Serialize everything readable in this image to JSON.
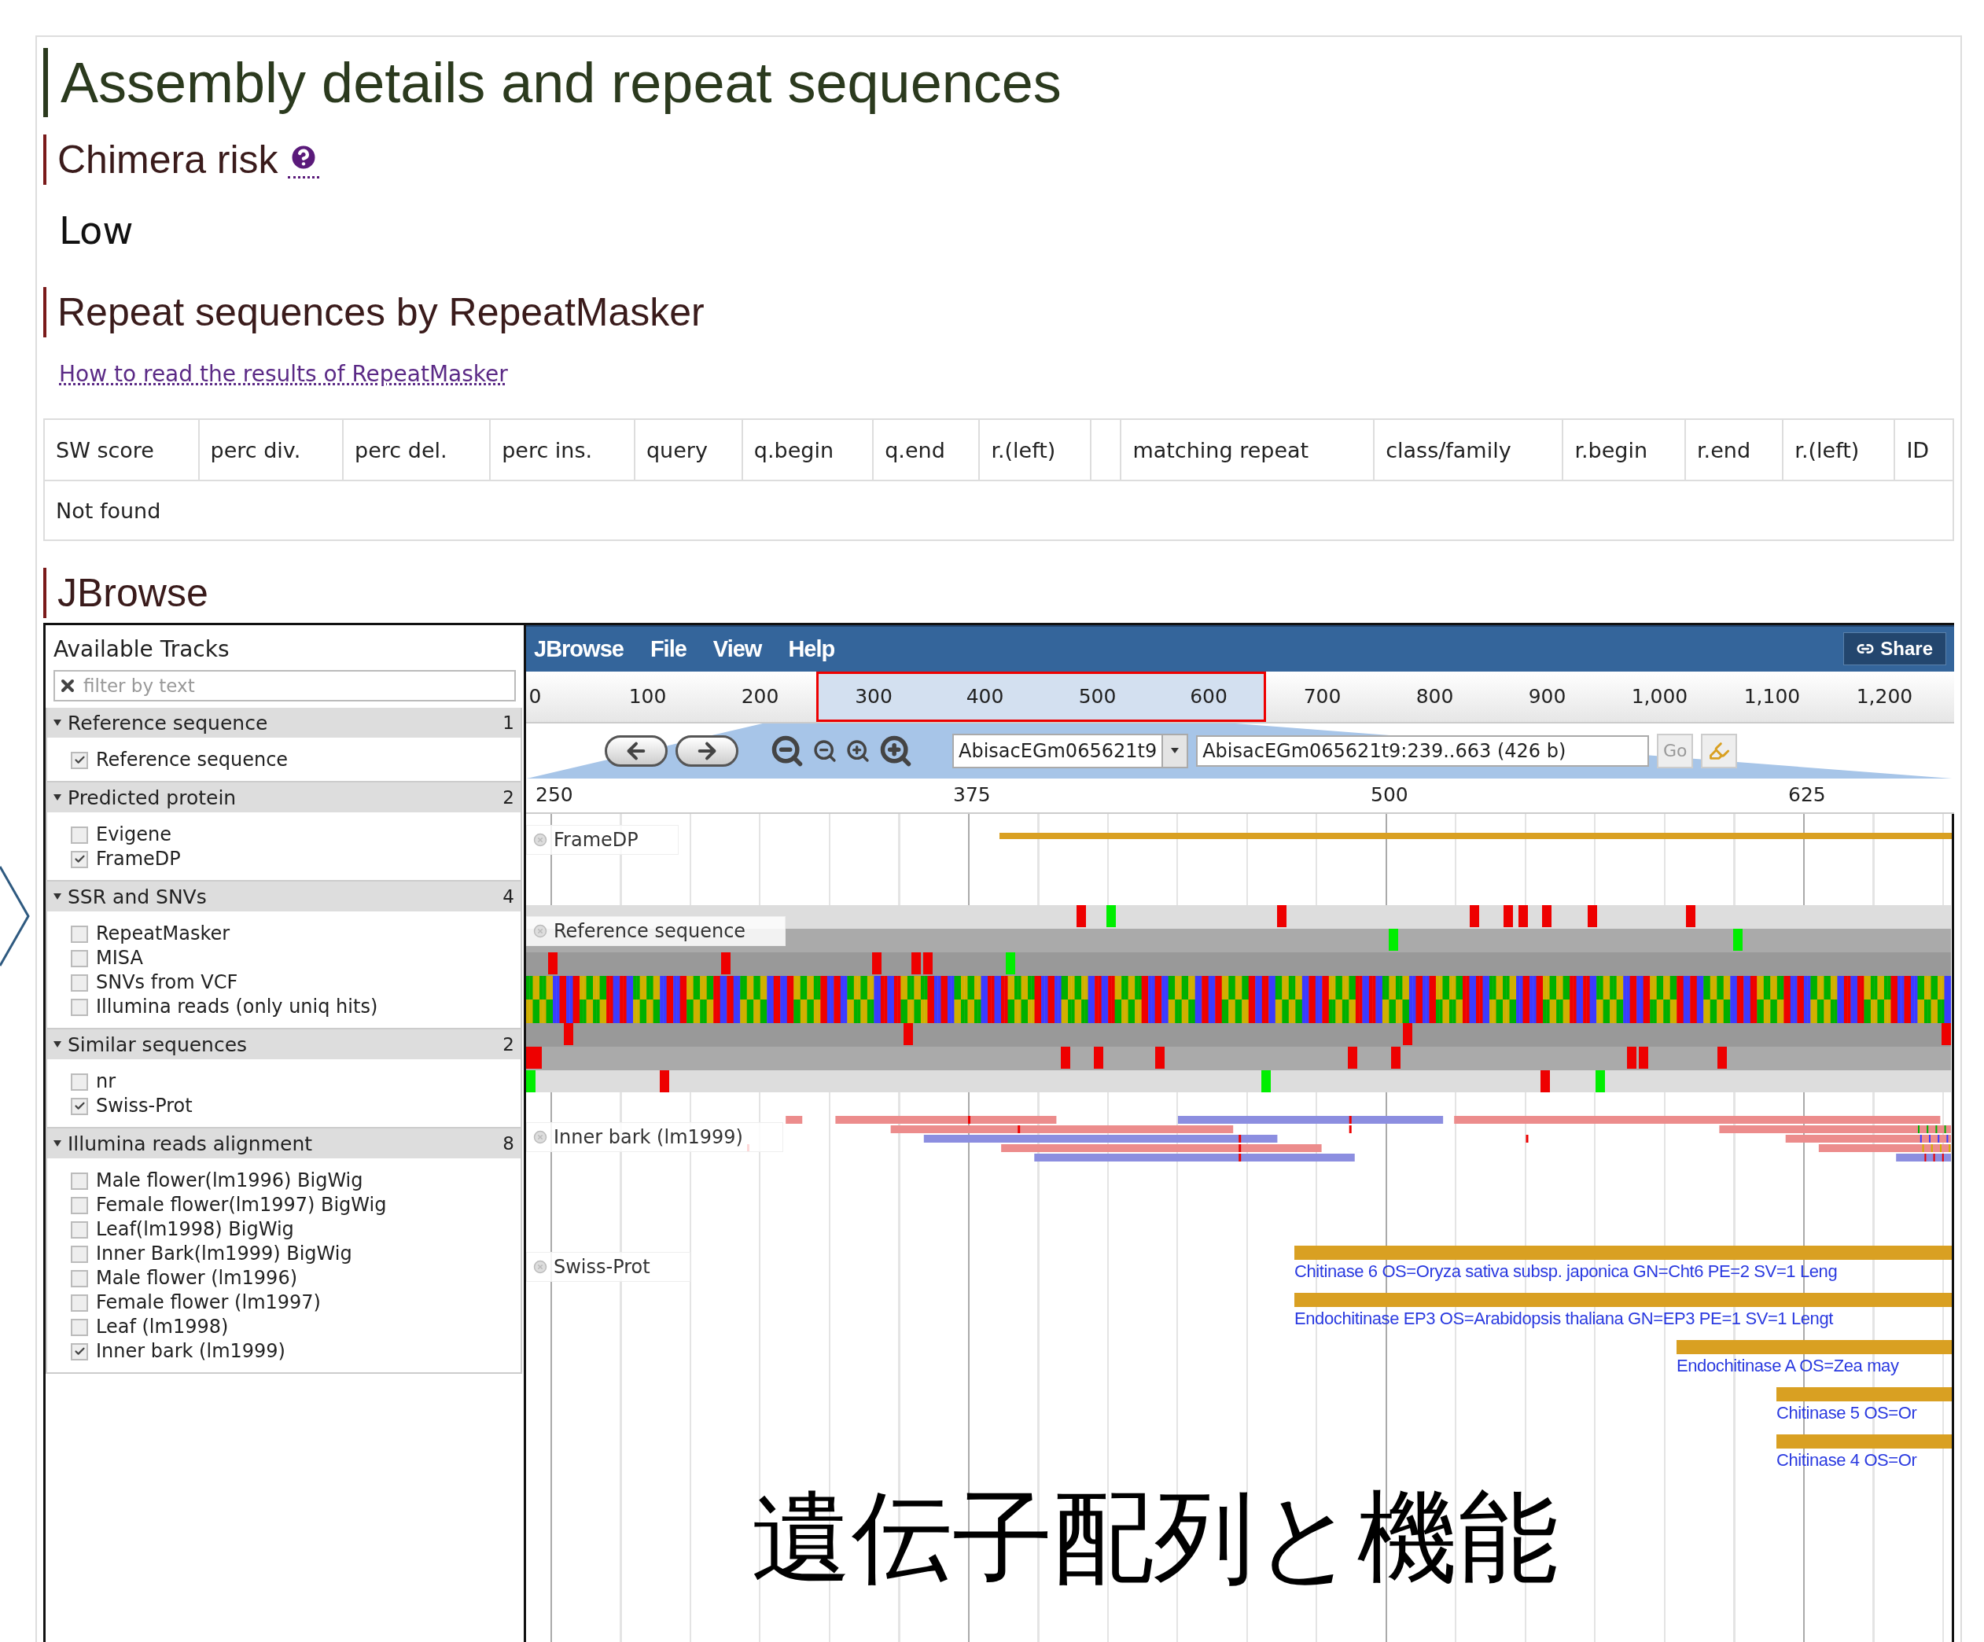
{
  "title": "Assembly details and repeat sequences",
  "chimera": {
    "heading": "Chimera risk",
    "value": "Low"
  },
  "repeats": {
    "heading": "Repeat sequences by RepeatMasker",
    "link": "How to read the results of RepeatMasker",
    "columns": [
      {
        "kind": "text",
        "label": "SW score"
      },
      {
        "kind": "text",
        "label": "perc div."
      },
      {
        "kind": "text",
        "label": "perc del."
      },
      {
        "kind": "text",
        "label": "perc ins."
      },
      {
        "kind": "text",
        "label": "query"
      },
      {
        "kind": "text",
        "label": "q.begin"
      },
      {
        "kind": "text",
        "label": "q.end"
      },
      {
        "kind": "text",
        "label": "r.(left)"
      },
      {
        "kind": "blank"
      },
      {
        "kind": "text",
        "label": "matching repeat"
      },
      {
        "kind": "text",
        "label": "class/family"
      },
      {
        "kind": "text",
        "label": "r.begin"
      },
      {
        "kind": "text",
        "label": "r.end"
      },
      {
        "kind": "text",
        "label": "r.(left)"
      },
      {
        "kind": "text",
        "label": "ID"
      }
    ],
    "empty": "Not found"
  },
  "jbrowse": {
    "heading": "JBrowse",
    "tracks_panel": {
      "title": "Available Tracks",
      "filter_placeholder": "filter by text",
      "groups": [
        {
          "name": "Reference sequence",
          "count": "1",
          "expanded": true,
          "tracks": [
            {
              "label": "Reference sequence",
              "checked": true
            }
          ]
        },
        {
          "name": "Predicted protein",
          "count": "2",
          "expanded": true,
          "tracks": [
            {
              "label": "Evigene",
              "checked": false
            },
            {
              "label": "FrameDP",
              "checked": true
            }
          ]
        },
        {
          "name": "SSR and SNVs",
          "count": "4",
          "expanded": true,
          "tracks": [
            {
              "label": "RepeatMasker",
              "checked": false
            },
            {
              "label": "MISA",
              "checked": false
            },
            {
              "label": "SNVs from VCF",
              "checked": false
            },
            {
              "label": "Illumina reads (only uniq hits)",
              "checked": false
            }
          ]
        },
        {
          "name": "Similar sequences",
          "count": "2",
          "expanded": true,
          "tracks": [
            {
              "label": "nr",
              "checked": false
            },
            {
              "label": "Swiss-Prot",
              "checked": true
            }
          ]
        },
        {
          "name": "Illumina reads alignment",
          "count": "8",
          "expanded": true,
          "tracks": [
            {
              "label": "Male flower(lm1996) BigWig",
              "checked": false
            },
            {
              "label": "Female flower(lm1997) BigWig",
              "checked": false
            },
            {
              "label": "Leaf(lm1998) BigWig",
              "checked": false
            },
            {
              "label": "Inner Bark(lm1999) BigWig",
              "checked": false
            },
            {
              "label": "Male flower (lm1996)",
              "checked": false
            },
            {
              "label": "Female flower (lm1997)",
              "checked": false
            },
            {
              "label": "Leaf (lm1998)",
              "checked": false
            },
            {
              "label": "Inner bark (lm1999)",
              "checked": true
            }
          ]
        }
      ]
    },
    "menu": [
      "JBrowse",
      "File",
      "View",
      "Help"
    ],
    "share": "Share",
    "overview_ticks": [
      {
        "label": "0",
        "highlighted": false
      },
      {
        "label": "100",
        "highlighted": false
      },
      {
        "label": "200",
        "highlighted": false
      },
      {
        "label": "300",
        "highlighted": true
      },
      {
        "label": "400",
        "highlighted": true
      },
      {
        "label": "500",
        "highlighted": true
      },
      {
        "label": "600",
        "highlighted": true
      },
      {
        "label": "700",
        "highlighted": false
      },
      {
        "label": "800",
        "highlighted": false
      },
      {
        "label": "900",
        "highlighted": false
      },
      {
        "label": "1,000",
        "highlighted": false
      },
      {
        "label": "1,100",
        "highlighted": false
      },
      {
        "label": "1,200",
        "highlighted": false
      }
    ],
    "reference": "AbisacEGm065621t9",
    "location": "AbisacEGm065621t9:239..663 (426 b)",
    "go": "Go",
    "detail_ticks": [
      "250",
      "375",
      "500",
      "625"
    ],
    "tracks": [
      {
        "kind": "feature",
        "label": "FrameDP"
      },
      {
        "kind": "sequence",
        "label": "Reference sequence"
      },
      {
        "kind": "alignments",
        "label": "Inner bark (lm1999)"
      },
      {
        "kind": "hits",
        "label": "Swiss-Prot",
        "hits": [
          "Chitinase 6 OS=Oryza sativa subsp. japonica GN=Cht6 PE=2 SV=1 Leng",
          "Endochitinase EP3 OS=Arabidopsis thaliana GN=EP3 PE=1 SV=1 Lengt",
          "Endochitinase A OS=Zea may",
          "Chitinase 5 OS=Or",
          "Chitinase 4 OS=Or"
        ]
      }
    ]
  },
  "caption": "遺伝子配列と機能"
}
